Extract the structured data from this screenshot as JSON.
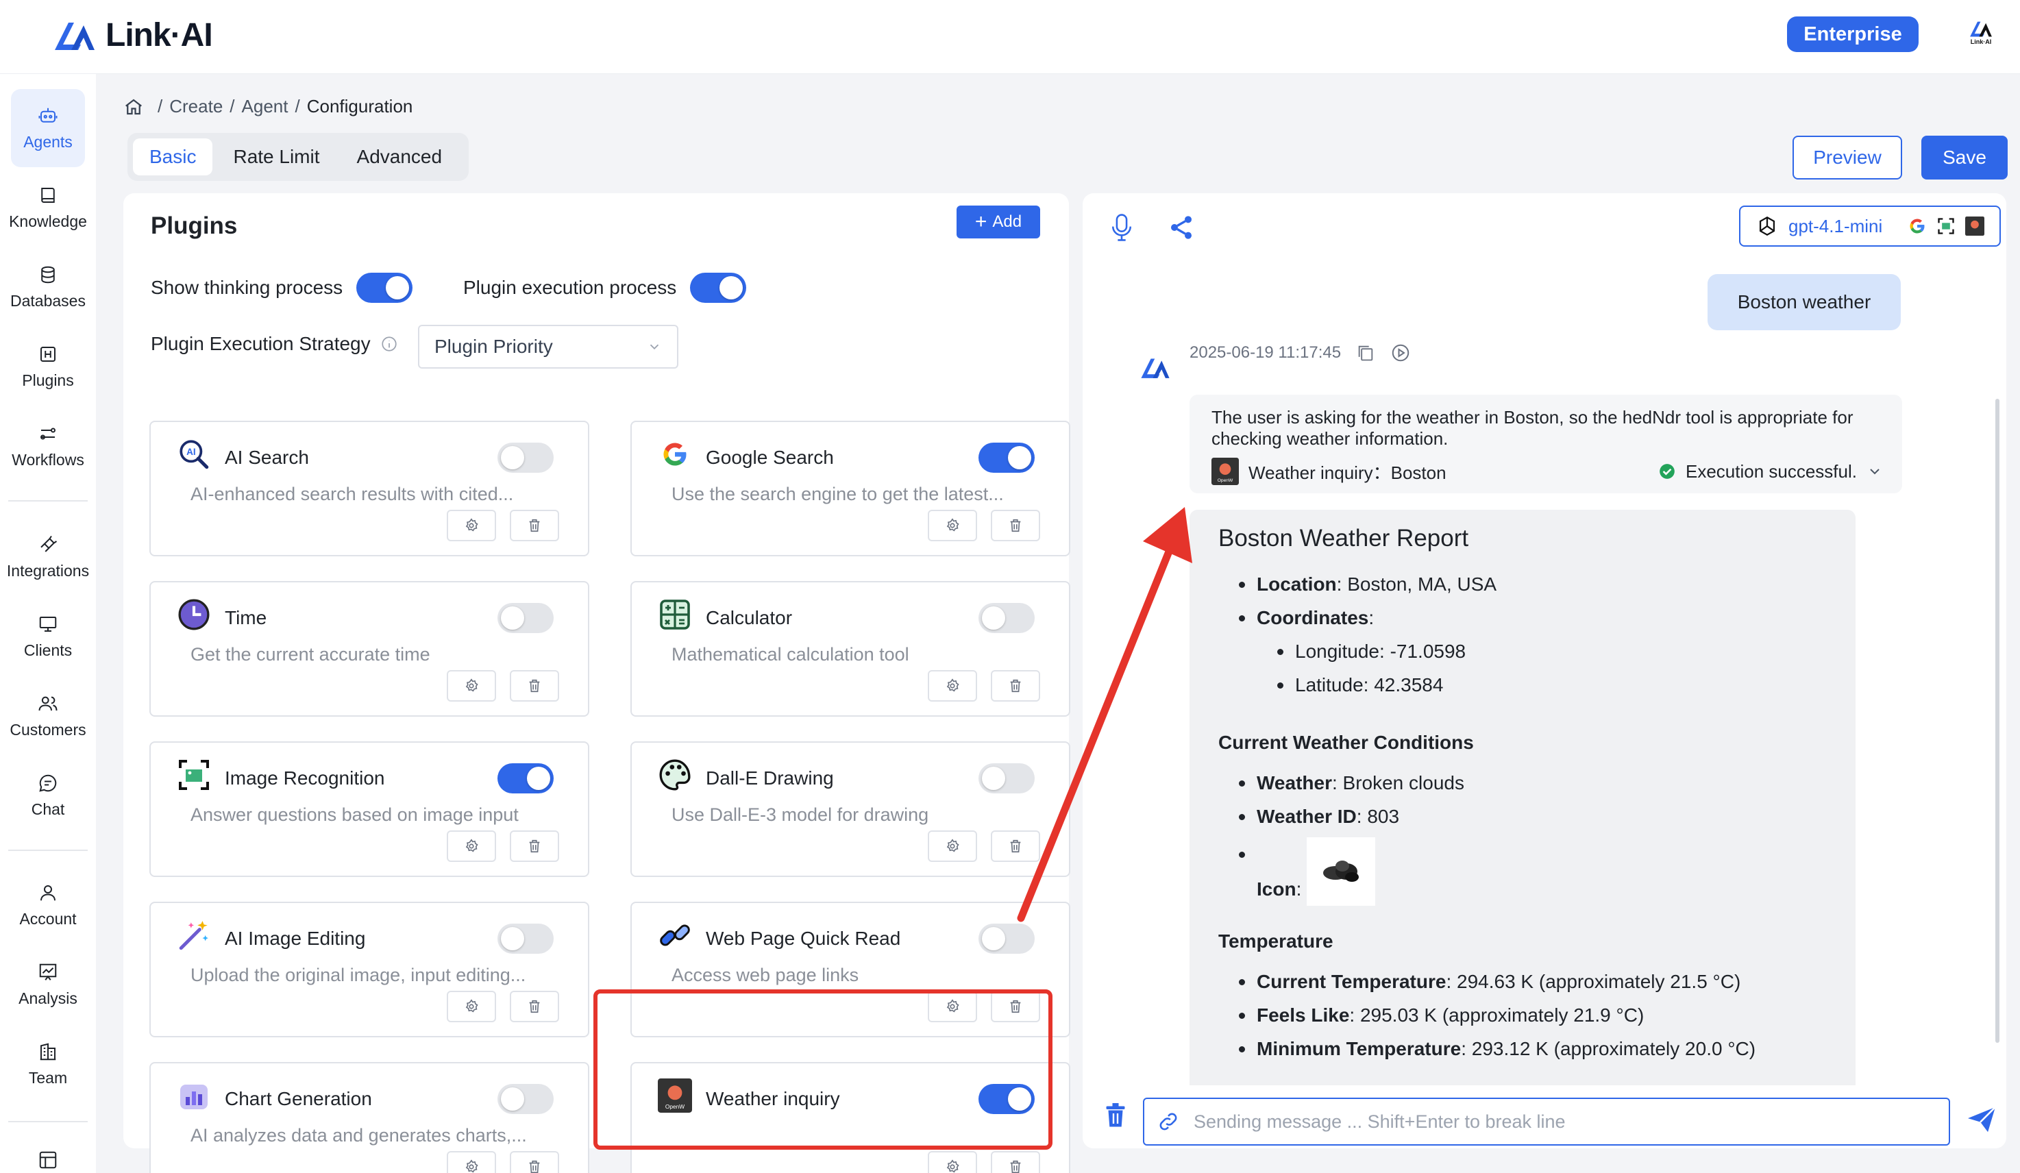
{
  "app": {
    "name": "Link·AI",
    "enterprise_label": "Enterprise",
    "avatar_label": "Link·AI"
  },
  "colors": {
    "accent": "#2f67e8",
    "highlight": "#e5342b",
    "success": "#22a35a"
  },
  "sidebar": {
    "items": [
      {
        "label": "Agents",
        "icon": "robot-icon"
      },
      {
        "label": "Knowledge",
        "icon": "book-icon"
      },
      {
        "label": "Databases",
        "icon": "database-icon"
      },
      {
        "label": "Plugins",
        "icon": "plugin-icon"
      },
      {
        "label": "Workflows",
        "icon": "workflow-icon"
      },
      {
        "label": "Integrations",
        "icon": "integration-icon"
      },
      {
        "label": "Clients",
        "icon": "monitor-icon"
      },
      {
        "label": "Customers",
        "icon": "users-icon"
      },
      {
        "label": "Chat",
        "icon": "chat-icon"
      },
      {
        "label": "Account",
        "icon": "person-icon"
      },
      {
        "label": "Analysis",
        "icon": "chart-icon"
      },
      {
        "label": "Team",
        "icon": "building-icon"
      }
    ]
  },
  "breadcrumb": {
    "create": "Create",
    "agent": "Agent",
    "current": "Configuration",
    "sep": "/"
  },
  "tabs": [
    "Basic",
    "Rate Limit",
    "Advanced"
  ],
  "actions": {
    "preview": "Preview",
    "save": "Save"
  },
  "plugins": {
    "title": "Plugins",
    "add_label": "Add",
    "show_thinking_label": "Show thinking process",
    "show_thinking_on": true,
    "plugin_exec_label": "Plugin execution process",
    "plugin_exec_on": true,
    "strategy_label": "Plugin Execution Strategy",
    "strategy_value": "Plugin Priority",
    "cards": [
      {
        "name": "AI Search",
        "desc": "AI-enhanced search results with cited...",
        "on": false,
        "icon": "ai-search-icon"
      },
      {
        "name": "Google Search",
        "desc": "Use the search engine to get the latest...",
        "on": true,
        "icon": "google-icon"
      },
      {
        "name": "Time",
        "desc": "Get the current accurate time",
        "on": false,
        "icon": "clock-icon"
      },
      {
        "name": "Calculator",
        "desc": "Mathematical calculation tool",
        "on": false,
        "icon": "calculator-icon"
      },
      {
        "name": "Image Recognition",
        "desc": "Answer questions based on image input",
        "on": true,
        "icon": "image-scan-icon"
      },
      {
        "name": "Dall-E Drawing",
        "desc": "Use Dall-E-3 model for drawing",
        "on": false,
        "icon": "palette-icon"
      },
      {
        "name": "AI Image Editing",
        "desc": "Upload the original image, input editing...",
        "on": false,
        "icon": "magic-wand-icon"
      },
      {
        "name": "Web Page Quick Read",
        "desc": "Access web page links",
        "on": false,
        "icon": "link-icon"
      },
      {
        "name": "Chart Generation",
        "desc": "AI analyzes data and generates charts,...",
        "on": false,
        "icon": "bar-chart-icon"
      },
      {
        "name": "Weather inquiry",
        "desc": "",
        "on": true,
        "icon": "openweather-icon"
      }
    ]
  },
  "chat": {
    "model": "gpt-4.1-mini",
    "user_message": "Boston weather",
    "timestamp": "2025-06-19 11:17:45",
    "thinking": "The user is asking for the weather in Boston, so the hedNdr tool is appropriate for checking weather information.",
    "tool_call": "Weather inquiry：Boston",
    "tool_status": "Execution successful.",
    "report": {
      "title": "Boston Weather Report",
      "location_label": "Location",
      "location_value": "Boston, MA, USA",
      "coordinates_label": "Coordinates",
      "longitude": "Longitude: -71.0598",
      "latitude": "Latitude: 42.3584",
      "conditions_title": "Current Weather Conditions",
      "weather_label": "Weather",
      "weather_value": "Broken clouds",
      "weather_id_label": "Weather ID",
      "weather_id_value": "803",
      "icon_label": "Icon",
      "temperature_title": "Temperature",
      "current_temp_label": "Current Temperature",
      "current_temp_value": "294.63 K (approximately 21.5 °C)",
      "feels_like_label": "Feels Like",
      "feels_like_value": "295.03 K (approximately 21.9 °C)",
      "min_temp_label": "Minimum Temperature",
      "min_temp_value": "293.12 K (approximately 20.0 °C)"
    },
    "input_placeholder": "Sending message ... Shift+Enter to break line"
  }
}
